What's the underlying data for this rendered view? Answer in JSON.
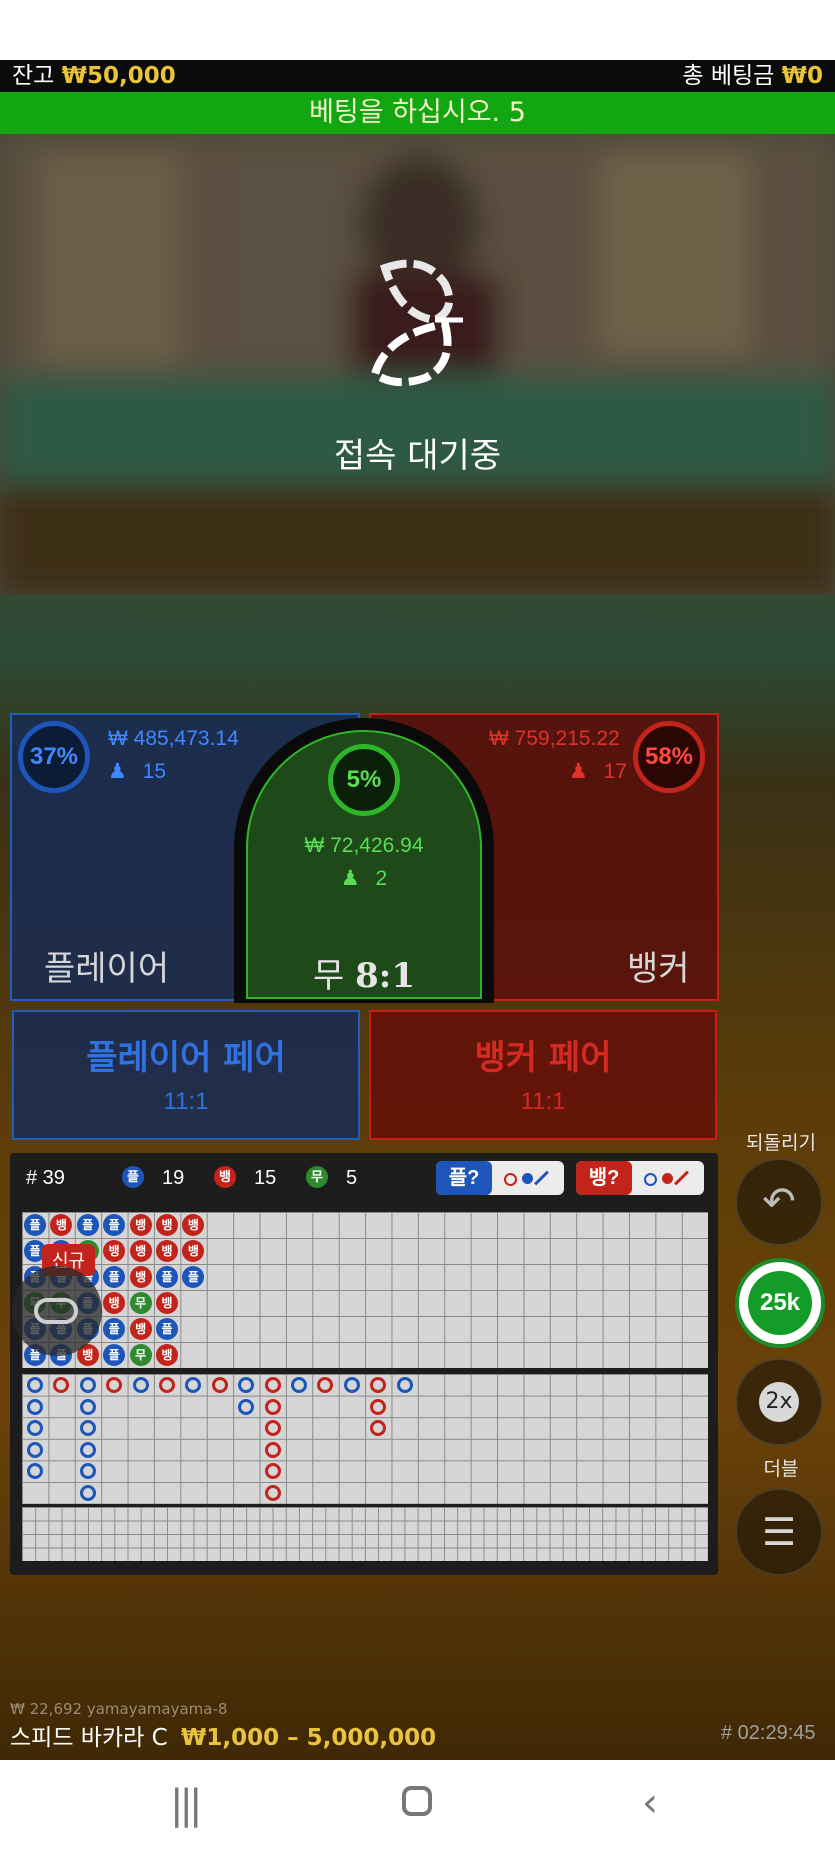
{
  "top": {
    "balance_label": "잔고",
    "balance_value": "₩50,000",
    "total_bet_label": "총 베팅금",
    "total_bet_value": "₩0"
  },
  "status_bar": "베팅을 하십시오. 5",
  "loading": {
    "text": "접속 대기중",
    "icon": "leaf-logo-spinner"
  },
  "bets": {
    "player": {
      "label": "플레이어",
      "percent": "37%",
      "amount": "₩ 485,473.14",
      "players": "15"
    },
    "tie": {
      "label": "무",
      "odds": "8:1",
      "percent": "5%",
      "amount": "₩ 72,426.94",
      "players": "2"
    },
    "banker": {
      "label": "뱅커",
      "percent": "58%",
      "amount": "₩ 759,215.22",
      "players": "17"
    },
    "player_pair": {
      "label": "플레이어 페어",
      "odds": "11:1"
    },
    "banker_pair": {
      "label": "뱅커 페어",
      "odds": "11:1"
    }
  },
  "road_stats": {
    "rounds": "# 39",
    "player_badge": "플",
    "player_count": "19",
    "banker_badge": "뱅",
    "banker_count": "15",
    "tie_badge": "무",
    "tie_count": "5",
    "player_predict": "플?",
    "banker_predict": "뱅?"
  },
  "bead_road": [
    [
      "플",
      "플",
      "플",
      "무",
      "플",
      "플"
    ],
    [
      "뱅",
      "플",
      "플",
      "무",
      "플",
      "플"
    ],
    [
      "플",
      "무",
      "플",
      "플",
      "플",
      "뱅"
    ],
    [
      "플",
      "뱅",
      "플",
      "뱅",
      "플",
      "플"
    ],
    [
      "뱅",
      "뱅",
      "뱅",
      "무",
      "뱅",
      "무"
    ],
    [
      "뱅",
      "뱅",
      "플",
      "뱅",
      "플",
      "뱅"
    ],
    [
      "뱅",
      "뱅",
      "플",
      "",
      "",
      ""
    ]
  ],
  "new_badge": "신규",
  "controls": {
    "undo_label": "되돌리기",
    "chip_value": "25k",
    "double_value": "2x",
    "double_label": "더블"
  },
  "footer": {
    "ticker": "₩ 22,692 yamayamayama-8",
    "table_name": "스피드 바카라 C",
    "limits": "₩1,000 – 5,000,000",
    "time": "# 02:29:45"
  },
  "colors": {
    "player": "#1d56b8",
    "banker": "#c2241c",
    "tie": "#2fb52a",
    "status_green": "#12a612",
    "gold": "#e8c33b"
  }
}
